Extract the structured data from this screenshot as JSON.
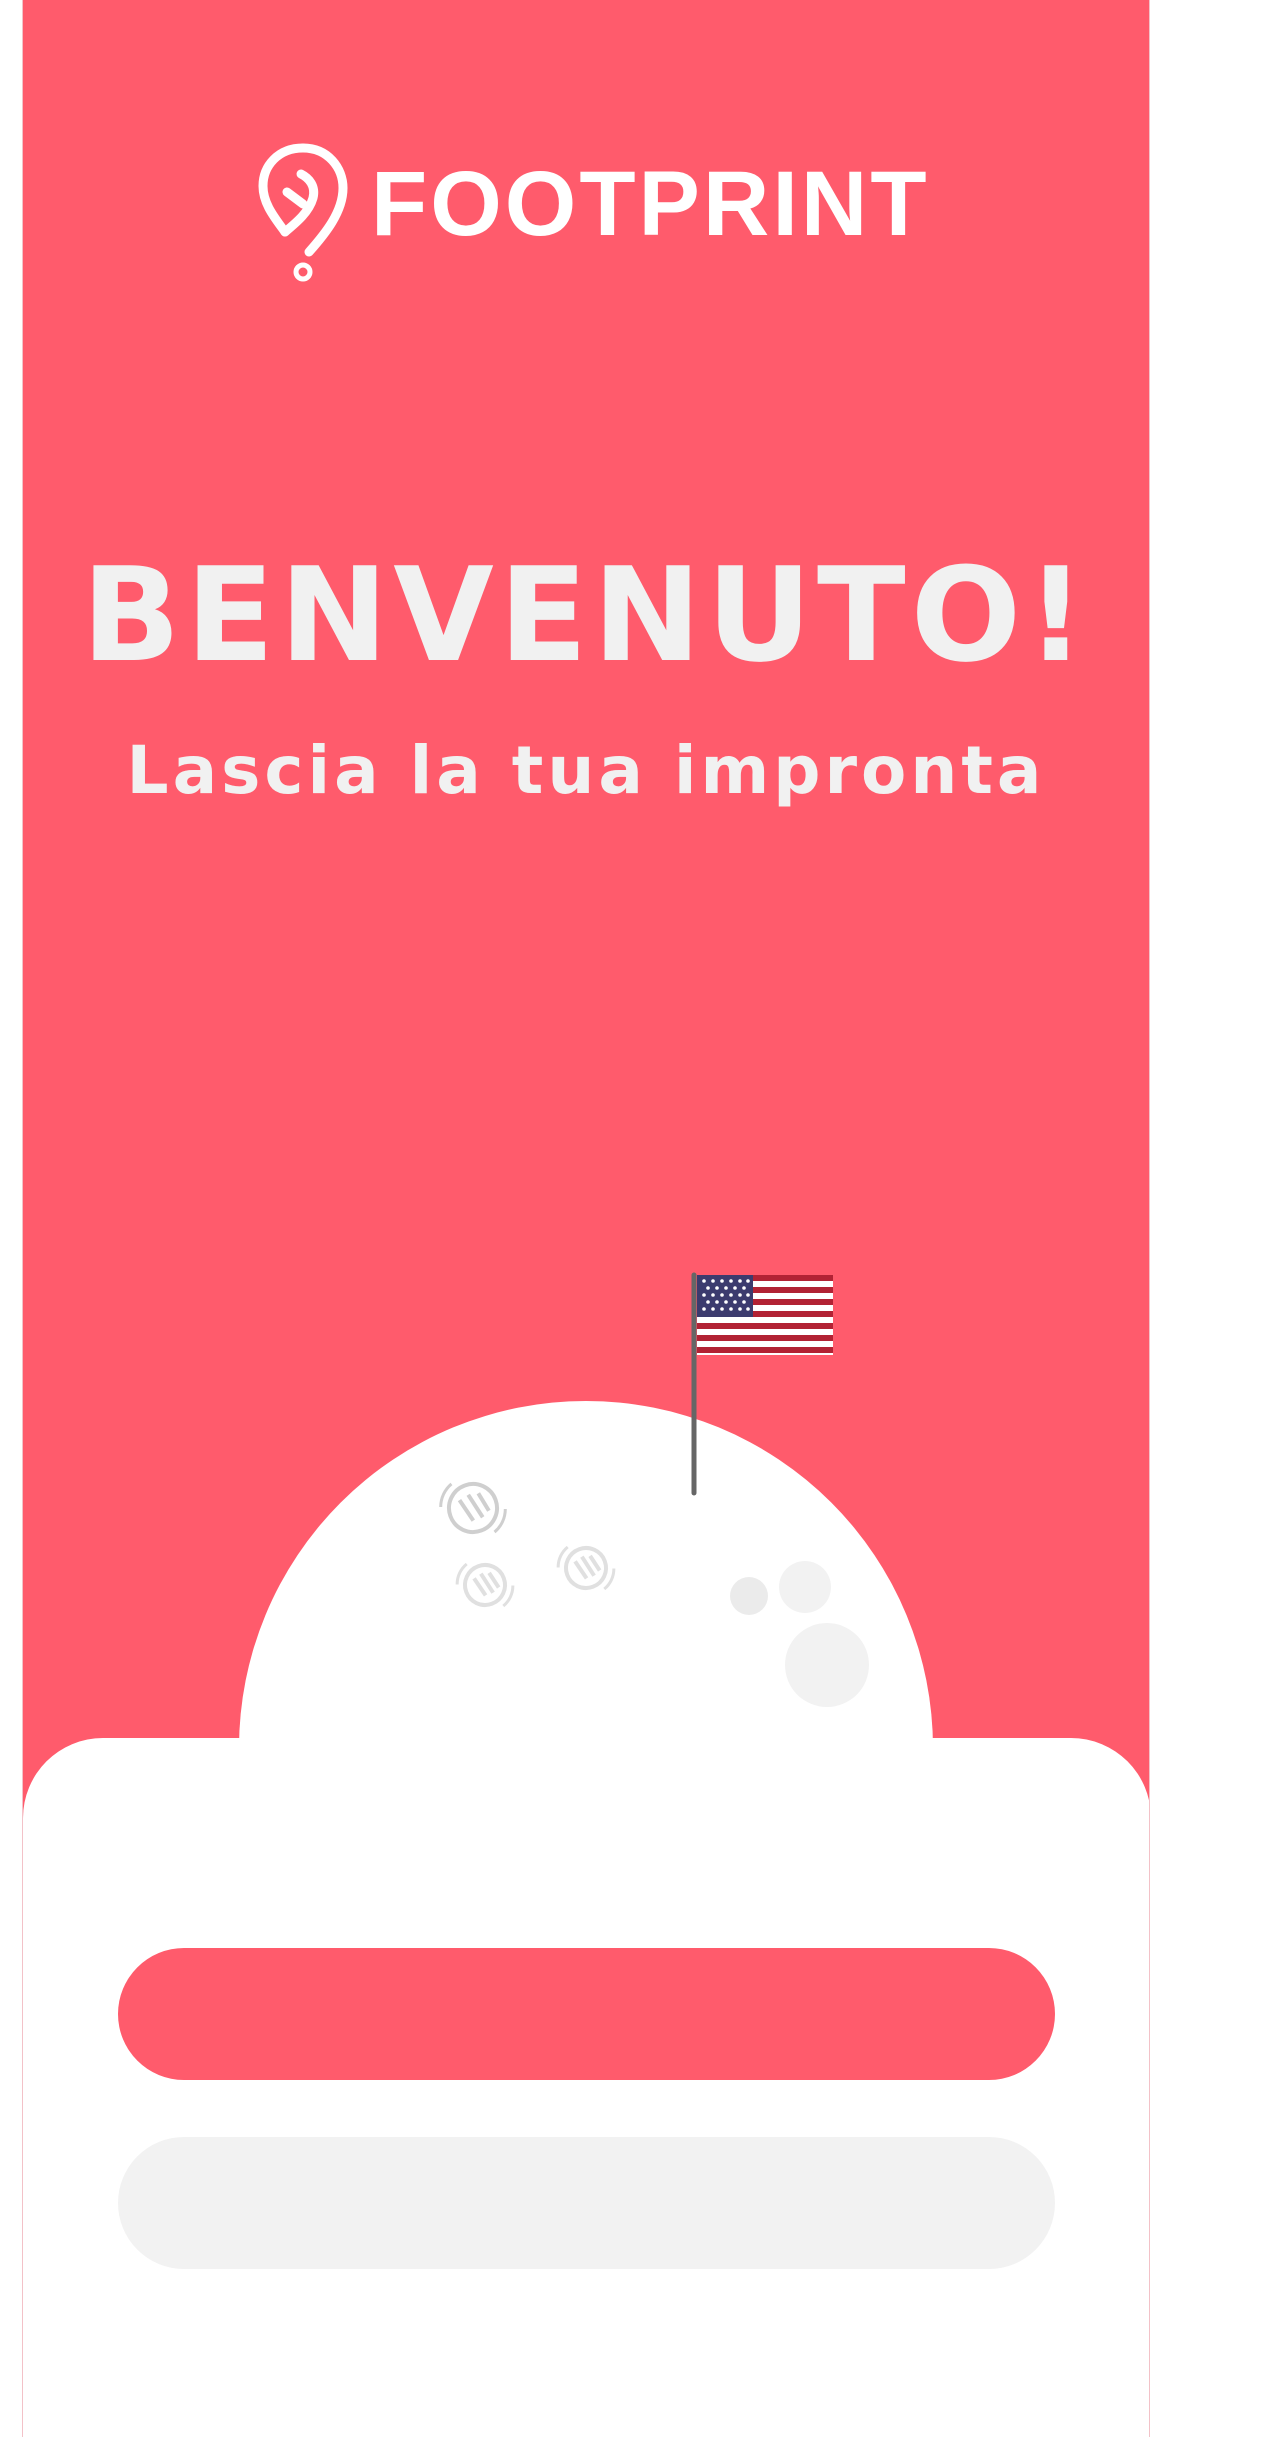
{
  "app": {
    "name": "FOOTPRINT"
  },
  "hero": {
    "title": "BENVENUTO!",
    "subtitle": "Lascia la tua impronta"
  },
  "actions": {
    "primary_label": "",
    "secondary_label": ""
  },
  "illustration": {
    "planet": "moon-planet",
    "flag": "us-flag-icon",
    "footprints": "footprint-icon"
  },
  "colors": {
    "brand": "#FF5B6C",
    "text_light": "#F1F1F1",
    "button_secondary": "#F2F2F2",
    "card": "#FFFFFF"
  }
}
